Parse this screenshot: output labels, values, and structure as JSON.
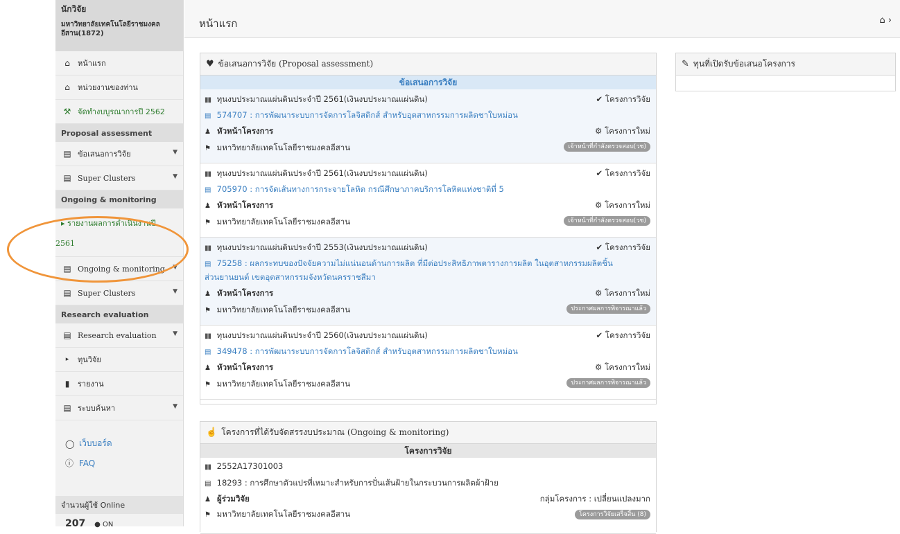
{
  "sidebar": {
    "user_name": "นักวิจัย",
    "user_org": "มหาวิทยาลัยเทคโนโลยีราชมงคลอีสาน(1872)",
    "items": {
      "home": "หน้าแรก",
      "unit": "หน่วยงานของท่าน",
      "budget": "จัดทำงบบูรณาการปี 2562",
      "proposal_section": "Proposal assessment",
      "proposal": "ข้อเสนอการวิจัย",
      "super_clusters_1": "Super Clusters",
      "ongoing_section": "Ongoing & monitoring",
      "report_line1": "รายงานผลการดำเนินงานปี",
      "report_line2": "2561",
      "ongoing": "Ongoing & monitoring",
      "super_clusters_2": "Super Clusters",
      "research_section": "Research evaluation",
      "research_eval": "Research evaluation",
      "fund": "ทุนวิจัย",
      "reports": "รายงาน",
      "search": "ระบบค้นหา"
    },
    "webboard": "เว็บบอร์ด",
    "faq": "FAQ",
    "online_label": "จำนวนผู้ใช้ Online",
    "online_count": "207",
    "online_suffix": "ON"
  },
  "header": {
    "title": "หน้าแรก"
  },
  "proposal_panel": {
    "title": "ข้อเสนอการวิจัย (Proposal assessment)",
    "table_header": "ข้อเสนอการวิจัย",
    "rows": [
      {
        "fund": "ทุนงบประมาณแผ่นดินประจำปี 2561(เงินงบประมาณแผ่นดิน)",
        "type": "โครงการวิจัย",
        "project": "574707 : การพัฒนาระบบการจัดการโลจิสติกส์ สำหรับอุตสาหกรรมการผลิตชาใบหม่อน",
        "project_line2": "",
        "role": "หัวหน้าโครงการ",
        "status": "โครงการใหม่",
        "org": "มหาวิทยาลัยเทคโนโลยีราชมงคลอีสาน",
        "badge": "เจ้าหน้าที่กำลังตรวจสอบ(วช)"
      },
      {
        "fund": "ทุนงบประมาณแผ่นดินประจำปี 2561(เงินงบประมาณแผ่นดิน)",
        "type": "โครงการวิจัย",
        "project": "705970 : การจัดเส้นทางการกระจายโลหิต กรณีศึกษาภาคบริการโลหิตแห่งชาติที่ 5",
        "project_line2": "",
        "role": "หัวหน้าโครงการ",
        "status": "โครงการใหม่",
        "org": "มหาวิทยาลัยเทคโนโลยีราชมงคลอีสาน",
        "badge": "เจ้าหน้าที่กำลังตรวจสอบ(วช)"
      },
      {
        "fund": "ทุนงบประมาณแผ่นดินประจำปี 2553(เงินงบประมาณแผ่นดิน)",
        "type": "โครงการวิจัย",
        "project": "75258 : ผลกระทบของปัจจัยความไม่แน่นอนด้านการผลิต ที่มีต่อประสิทธิภาพตารางการผลิต ในอุตสาหกรรมผลิตชิ้น",
        "project_line2": "ส่วนยานยนต์ เขตอุตสาหกรรมจังหวัดนครราชสีมา",
        "role": "หัวหน้าโครงการ",
        "status": "โครงการใหม่",
        "org": "มหาวิทยาลัยเทคโนโลยีราชมงคลอีสาน",
        "badge": "ประกาศผลการพิจารณาแล้ว"
      },
      {
        "fund": "ทุนงบประมาณแผ่นดินประจำปี 2560(เงินงบประมาณแผ่นดิน)",
        "type": "โครงการวิจัย",
        "project": "349478 : การพัฒนาระบบการจัดการโลจิสติกส์ สำหรับอุตสาหกรรมการผลิตชาใบหม่อน",
        "project_line2": "",
        "role": "หัวหน้าโครงการ",
        "status": "โครงการใหม่",
        "org": "มหาวิทยาลัยเทคโนโลยีราชมงคลอีสาน",
        "badge": "ประกาศผลการพิจารณาแล้ว"
      }
    ]
  },
  "ongoing_panel": {
    "title": "โครงการที่ได้รับจัดสรรงบประมาณ (Ongoing & monitoring)",
    "table_header": "โครงการวิจัย",
    "row": {
      "code": "2552A17301003",
      "project": "18293 : การศึกษาตัวแปรที่เหมาะสำหรับการปั่นเส้นฝ้ายในกระบวนการผลิตผ้าฝ้าย",
      "role": "ผู้ร่วมวิจัย",
      "group": "กลุ่มโครงการ : เปลี่ยนแปลงมาก",
      "org": "มหาวิทยาลัยเทคโนโลยีราชมงคลอีสาน",
      "badge": "โครงการวิจัยเสร็จสิ้น (8)"
    }
  },
  "funds_panel": {
    "title": "ทุนที่เปิดรับข้อเสนอโครงการ"
  },
  "colors": {
    "accent_blue": "#3a7fc1",
    "green": "#2f7d2f",
    "highlight_orange": "#f0953a"
  }
}
